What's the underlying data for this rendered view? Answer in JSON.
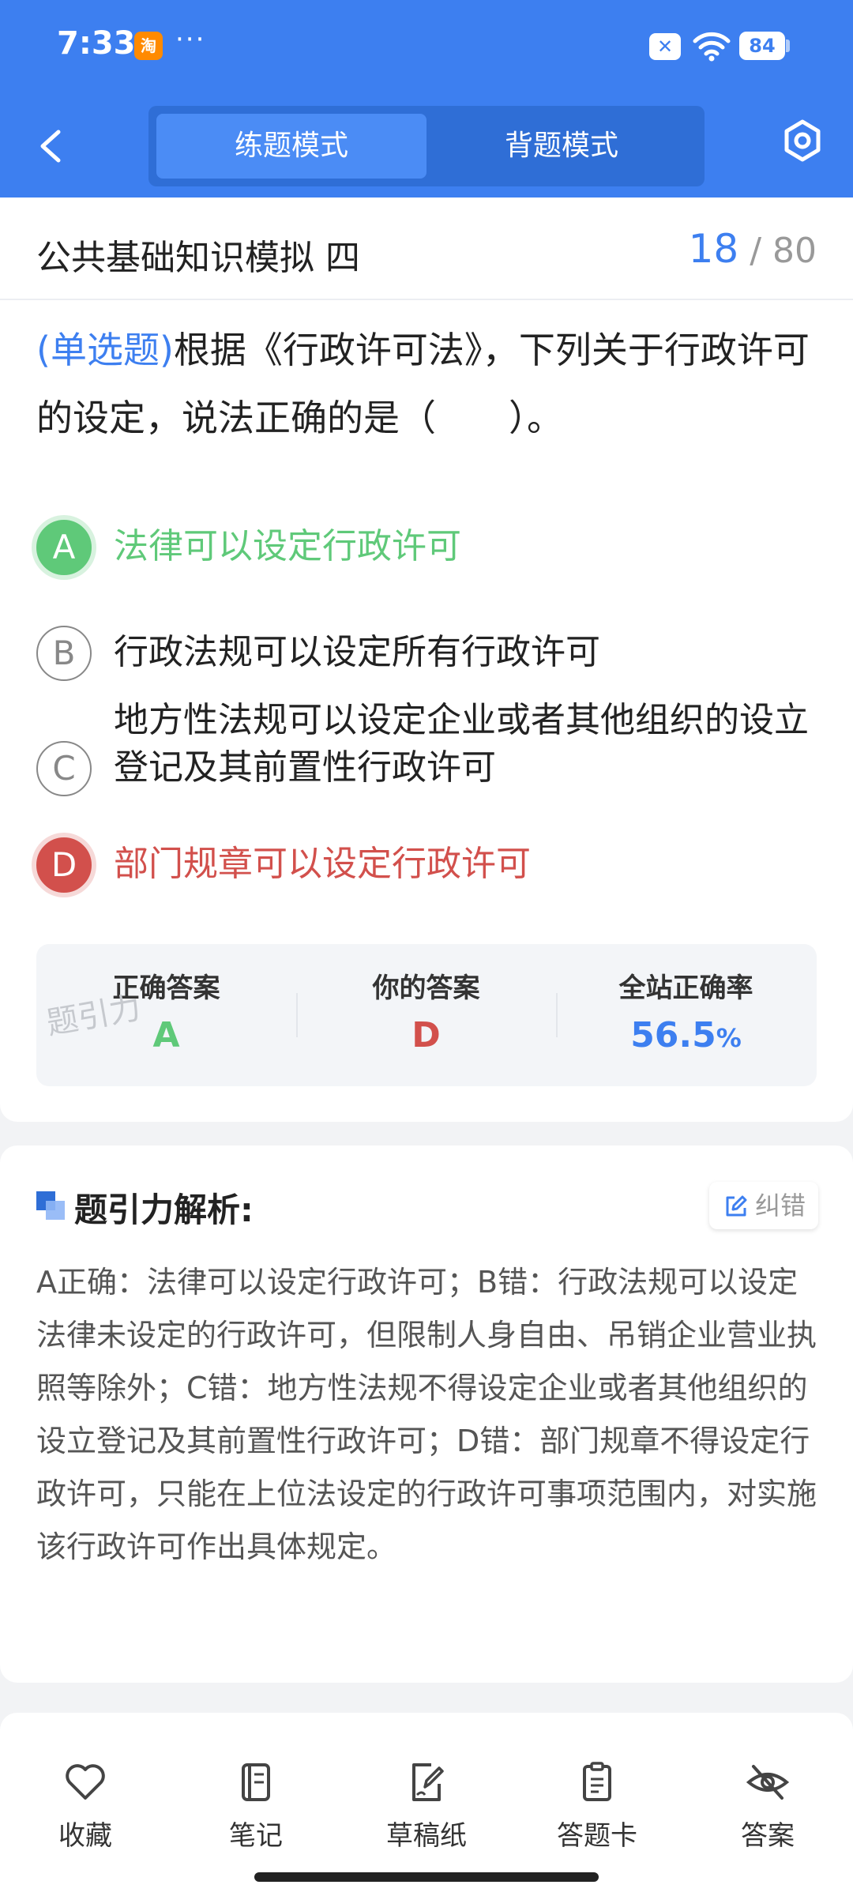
{
  "status_bar": {
    "time": "7:33",
    "app_badge": "淘",
    "dots": "···",
    "battery": "84"
  },
  "header": {
    "tabs": [
      {
        "label": "练题模式",
        "active": true
      },
      {
        "label": "背题模式",
        "active": false
      }
    ]
  },
  "exam": {
    "title": "公共基础知识模拟 四",
    "current": "18",
    "total": "/ 80"
  },
  "question": {
    "type": "(单选题)",
    "text": "根据《行政许可法》，下列关于行政许可的设定，说法正确的是（　　）。",
    "options": [
      {
        "letter": "A",
        "text": "法律可以设定行政许可",
        "state": "correct"
      },
      {
        "letter": "B",
        "text": "行政法规可以设定所有行政许可",
        "state": "normal"
      },
      {
        "letter": "C",
        "text": "地方性法规可以设定企业或者其他组织的设立登记及其前置性行政许可",
        "state": "normal"
      },
      {
        "letter": "D",
        "text": "部门规章可以设定行政许可",
        "state": "wrong"
      }
    ]
  },
  "answer_summary": {
    "correct_label": "正确答案",
    "correct_value": "A",
    "yours_label": "你的答案",
    "yours_value": "D",
    "rate_label": "全站正确率",
    "rate_value": "56.5",
    "rate_unit": "%",
    "watermark": "题引力"
  },
  "analysis": {
    "title": "题引力解析:",
    "fix_label": "纠错",
    "body": "A正确：法律可以设定行政许可；B错：行政法规可以设定法律未设定的行政许可，但限制人身自由、吊销企业营业执照等除外；C错：地方性法规不得设定企业或者其他组织的设立登记及其前置性行政许可；D错：部门规章不得设定行政许可，只能在上位法设定的行政许可事项范围内，对实施该行政许可作出具体规定。"
  },
  "bottom_nav": [
    {
      "label": "收藏",
      "icon": "heart-icon"
    },
    {
      "label": "笔记",
      "icon": "notebook-icon"
    },
    {
      "label": "草稿纸",
      "icon": "draft-icon"
    },
    {
      "label": "答题卡",
      "icon": "answer-sheet-icon"
    },
    {
      "label": "答案",
      "icon": "eye-off-icon"
    }
  ],
  "colors": {
    "primary": "#3d7ff0",
    "correct": "#5fc979",
    "wrong": "#d2504c"
  }
}
